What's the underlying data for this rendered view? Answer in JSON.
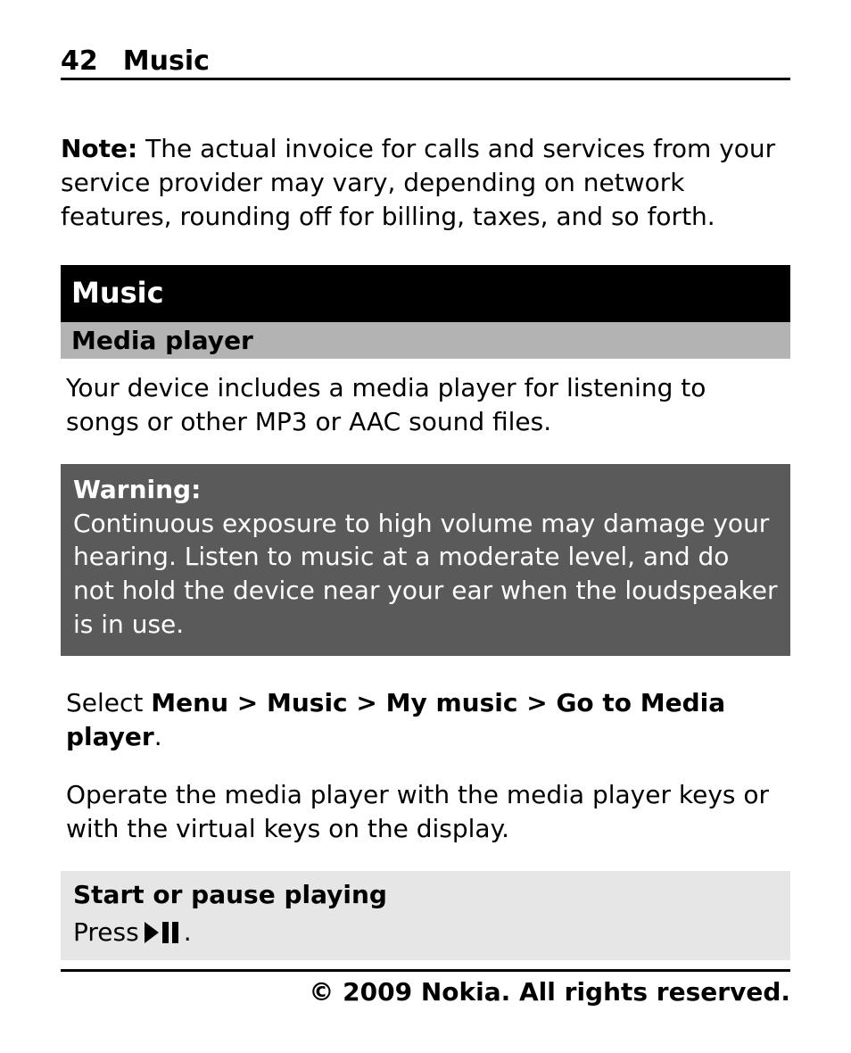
{
  "header": {
    "page_number": "42",
    "title": "Music"
  },
  "note": {
    "label": "Note:",
    "text": "  The actual invoice for calls and services from your service provider may vary, depending on network features, rounding off for billing, taxes, and so forth."
  },
  "sections": {
    "music": {
      "title": "Music"
    },
    "media_player": {
      "title": "Media player",
      "intro": "Your device includes a media player for listening to songs or other MP3 or AAC sound files."
    }
  },
  "warning": {
    "title": "Warning:",
    "text": "Continuous exposure to high volume may damage your hearing. Listen to music at a moderate level, and do not hold the device near your ear when the loudspeaker is in use."
  },
  "nav": {
    "prefix": "Select ",
    "items": [
      "Menu",
      "Music",
      "My music",
      "Go to Media player"
    ],
    "sep": " > ",
    "suffix": "."
  },
  "operate": "Operate the media player with the media player keys or with the virtual keys on the display.",
  "start_pause": {
    "title": "Start or pause playing",
    "press_prefix": "Press ",
    "press_suffix": "."
  },
  "footer": "© 2009 Nokia. All rights reserved."
}
